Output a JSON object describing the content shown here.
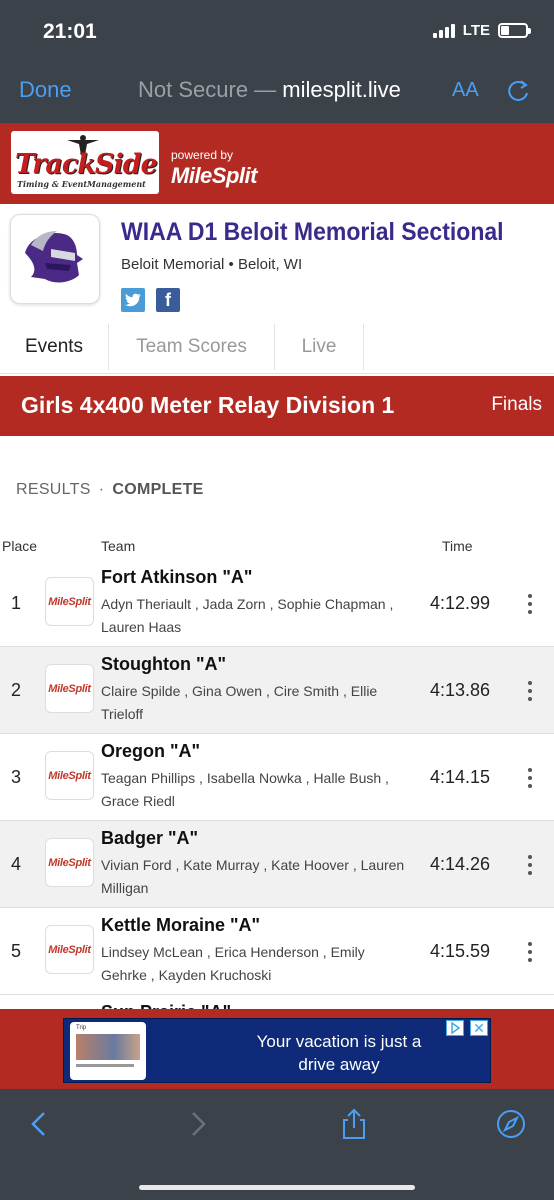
{
  "status_bar": {
    "time": "21:01",
    "network": "LTE",
    "battery_level": 0.35
  },
  "browser": {
    "done_label": "Done",
    "security": "Not Secure —",
    "domain": "milesplit.live",
    "text_size_label": "AA",
    "accent_color": "#4a9ff5"
  },
  "brand": {
    "logo_title": "TrackSide",
    "logo_subtitle": "Timing & EventManagement",
    "powered_by": "powered by",
    "partner": "MileSplit",
    "bar_color": "#b32a22"
  },
  "meet": {
    "title": "WIAA D1 Beloit Memorial Sectional",
    "location": "Beloit Memorial • Beloit, WI",
    "social": [
      "twitter-icon",
      "facebook-icon"
    ]
  },
  "tabs": [
    {
      "label": "Events",
      "active": true
    },
    {
      "label": "Team Scores",
      "active": false
    },
    {
      "label": "Live",
      "active": false
    }
  ],
  "event": {
    "name": "Girls 4x400 Meter Relay Division 1",
    "round": "Finals"
  },
  "results": {
    "label": "RESULTS",
    "separator": "·",
    "status": "COMPLETE"
  },
  "table": {
    "headers": {
      "place": "Place",
      "team": "Team",
      "time": "Time"
    },
    "rows": [
      {
        "place": "1",
        "logo": "MileSplit",
        "team": "Fort Atkinson \"A\"",
        "athletes": "Adyn Theriault , Jada Zorn , Sophie Chapman , Lauren Haas",
        "time": "4:12.99"
      },
      {
        "place": "2",
        "logo": "MileSplit",
        "team": "Stoughton \"A\"",
        "athletes": "Claire Spilde , Gina Owen , Cire Smith , Ellie Trieloff",
        "time": "4:13.86"
      },
      {
        "place": "3",
        "logo": "MileSplit",
        "team": "Oregon \"A\"",
        "athletes": "Teagan Phillips , Isabella Nowka , Halle Bush , Grace Riedl",
        "time": "4:14.15"
      },
      {
        "place": "4",
        "logo": "MileSplit",
        "team": "Badger \"A\"",
        "athletes": "Vivian Ford , Kate Murray , Kate Hoover , Lauren Milligan",
        "time": "4:14.26"
      },
      {
        "place": "5",
        "logo": "MileSplit",
        "team": "Kettle Moraine \"A\"",
        "athletes": "Lindsey McLean , Erica Henderson , Emily Gehrke , Kayden Kruchoski",
        "time": "4:15.59"
      }
    ],
    "partial_row_team": "Sun Prairie \"A\""
  },
  "ad": {
    "text": "Your vacation is just a drive away",
    "thumb_label": "Trip",
    "choices_icon": "ad-choices-icon",
    "close_icon": "close-icon"
  },
  "toolbar": {
    "icons": [
      "back-icon",
      "forward-icon",
      "share-icon",
      "compass-icon"
    ]
  }
}
